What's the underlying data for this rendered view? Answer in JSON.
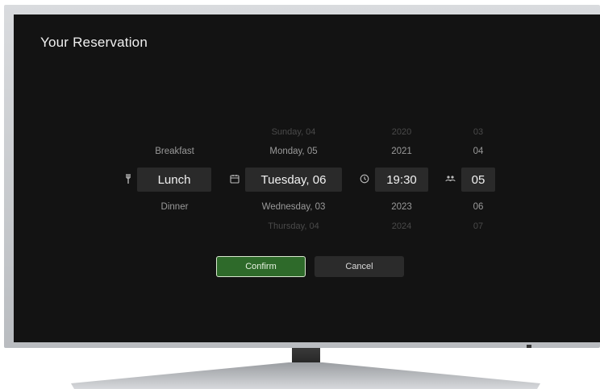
{
  "screen": {
    "title": "Your Reservation"
  },
  "meal": {
    "prev": "Breakfast",
    "selected": "Lunch",
    "next": "Dinner"
  },
  "date": {
    "prev2": "Sunday, 04",
    "prev": "Monday, 05",
    "selected": "Tuesday, 06",
    "next": "Wednesday, 03",
    "next2": "Thursday, 04"
  },
  "time": {
    "prev2": "2020",
    "prev": "2021",
    "selected": "19:30",
    "next": "2023",
    "next2": "2024"
  },
  "guests": {
    "prev2": "03",
    "prev": "04",
    "selected": "05",
    "next": "06",
    "next2": "07"
  },
  "buttons": {
    "confirm": "Confirm",
    "cancel": "Cancel"
  },
  "icons": {
    "meal": "fork-knife-icon",
    "date": "calendar-icon",
    "time": "clock-icon",
    "guests": "people-icon"
  },
  "colors": {
    "accent": "#2e6a2a",
    "background": "#131313",
    "field": "#2a2a2a"
  }
}
